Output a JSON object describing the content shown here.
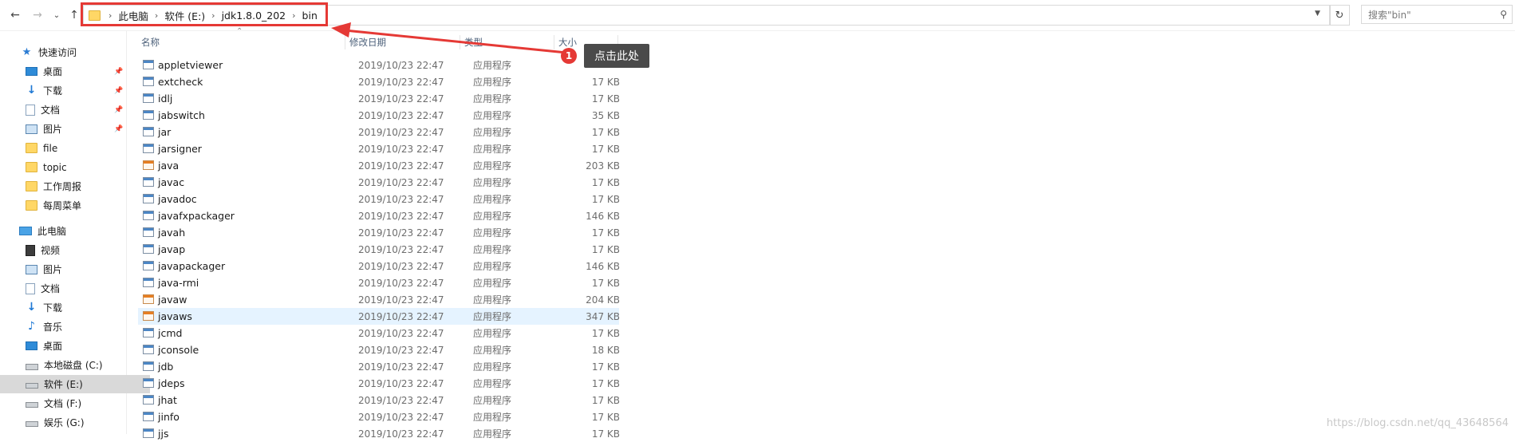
{
  "breadcrumb": [
    "此电脑",
    "软件 (E:)",
    "jdk1.8.0_202",
    "bin"
  ],
  "search": {
    "placeholder": "搜索\"bin\""
  },
  "columns": {
    "name": "名称",
    "date": "修改日期",
    "type": "类型",
    "size": "大小"
  },
  "sidebar": {
    "quick_access": "快速访问",
    "quick_items": [
      {
        "label": "桌面",
        "icon": "desktop-icon",
        "pinned": true
      },
      {
        "label": "下载",
        "icon": "download-icon",
        "pinned": true
      },
      {
        "label": "文档",
        "icon": "document-icon",
        "pinned": true
      },
      {
        "label": "图片",
        "icon": "picture-icon",
        "pinned": true
      },
      {
        "label": "file",
        "icon": "folder-icon",
        "pinned": false
      },
      {
        "label": "topic",
        "icon": "folder-icon",
        "pinned": false
      },
      {
        "label": "工作周报",
        "icon": "folder-icon",
        "pinned": false
      },
      {
        "label": "每周菜单",
        "icon": "folder-icon",
        "pinned": false
      }
    ],
    "this_pc": "此电脑",
    "pc_items": [
      {
        "label": "视频",
        "icon": "video-icon"
      },
      {
        "label": "图片",
        "icon": "picture-icon"
      },
      {
        "label": "文档",
        "icon": "document-icon"
      },
      {
        "label": "下载",
        "icon": "download-icon"
      },
      {
        "label": "音乐",
        "icon": "music-icon"
      },
      {
        "label": "桌面",
        "icon": "desktop-icon"
      },
      {
        "label": "本地磁盘 (C:)",
        "icon": "system-drive-icon"
      },
      {
        "label": "软件 (E:)",
        "icon": "drive-icon",
        "selected": true
      },
      {
        "label": "文档 (F:)",
        "icon": "drive-icon"
      },
      {
        "label": "娱乐 (G:)",
        "icon": "drive-icon"
      }
    ]
  },
  "files": [
    {
      "name": "appletviewer",
      "date": "2019/10/23 22:47",
      "type": "应用程序",
      "size": "",
      "java": false
    },
    {
      "name": "extcheck",
      "date": "2019/10/23 22:47",
      "type": "应用程序",
      "size": "17 KB",
      "java": false
    },
    {
      "name": "idlj",
      "date": "2019/10/23 22:47",
      "type": "应用程序",
      "size": "17 KB",
      "java": false
    },
    {
      "name": "jabswitch",
      "date": "2019/10/23 22:47",
      "type": "应用程序",
      "size": "35 KB",
      "java": false
    },
    {
      "name": "jar",
      "date": "2019/10/23 22:47",
      "type": "应用程序",
      "size": "17 KB",
      "java": false
    },
    {
      "name": "jarsigner",
      "date": "2019/10/23 22:47",
      "type": "应用程序",
      "size": "17 KB",
      "java": false
    },
    {
      "name": "java",
      "date": "2019/10/23 22:47",
      "type": "应用程序",
      "size": "203 KB",
      "java": true
    },
    {
      "name": "javac",
      "date": "2019/10/23 22:47",
      "type": "应用程序",
      "size": "17 KB",
      "java": false
    },
    {
      "name": "javadoc",
      "date": "2019/10/23 22:47",
      "type": "应用程序",
      "size": "17 KB",
      "java": false
    },
    {
      "name": "javafxpackager",
      "date": "2019/10/23 22:47",
      "type": "应用程序",
      "size": "146 KB",
      "java": false
    },
    {
      "name": "javah",
      "date": "2019/10/23 22:47",
      "type": "应用程序",
      "size": "17 KB",
      "java": false
    },
    {
      "name": "javap",
      "date": "2019/10/23 22:47",
      "type": "应用程序",
      "size": "17 KB",
      "java": false
    },
    {
      "name": "javapackager",
      "date": "2019/10/23 22:47",
      "type": "应用程序",
      "size": "146 KB",
      "java": false
    },
    {
      "name": "java-rmi",
      "date": "2019/10/23 22:47",
      "type": "应用程序",
      "size": "17 KB",
      "java": false
    },
    {
      "name": "javaw",
      "date": "2019/10/23 22:47",
      "type": "应用程序",
      "size": "204 KB",
      "java": true
    },
    {
      "name": "javaws",
      "date": "2019/10/23 22:47",
      "type": "应用程序",
      "size": "347 KB",
      "java": true,
      "hover": true
    },
    {
      "name": "jcmd",
      "date": "2019/10/23 22:47",
      "type": "应用程序",
      "size": "17 KB",
      "java": false
    },
    {
      "name": "jconsole",
      "date": "2019/10/23 22:47",
      "type": "应用程序",
      "size": "18 KB",
      "java": false
    },
    {
      "name": "jdb",
      "date": "2019/10/23 22:47",
      "type": "应用程序",
      "size": "17 KB",
      "java": false
    },
    {
      "name": "jdeps",
      "date": "2019/10/23 22:47",
      "type": "应用程序",
      "size": "17 KB",
      "java": false
    },
    {
      "name": "jhat",
      "date": "2019/10/23 22:47",
      "type": "应用程序",
      "size": "17 KB",
      "java": false
    },
    {
      "name": "jinfo",
      "date": "2019/10/23 22:47",
      "type": "应用程序",
      "size": "17 KB",
      "java": false
    },
    {
      "name": "jjs",
      "date": "2019/10/23 22:47",
      "type": "应用程序",
      "size": "17 KB",
      "java": false
    }
  ],
  "annotation": {
    "badge": "1",
    "tooltip": "点击此处",
    "color": "#e53935"
  },
  "watermark": "https://blog.csdn.net/qq_43648564"
}
